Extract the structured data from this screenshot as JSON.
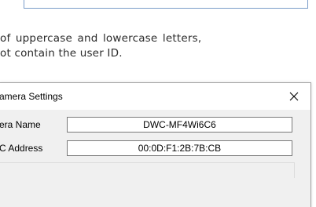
{
  "instructions": {
    "line1": "of uppercase and lowercase letters,",
    "line2": "ot contain the user ID."
  },
  "dialog": {
    "title": "amera Settings",
    "close_icon": "close-icon",
    "camera_name": {
      "label": "era Name",
      "value": "DWC-MF4Wi6C6"
    },
    "mac_address": {
      "label": "C Address",
      "value": "00:0D:F1:2B:7B:CB"
    }
  }
}
